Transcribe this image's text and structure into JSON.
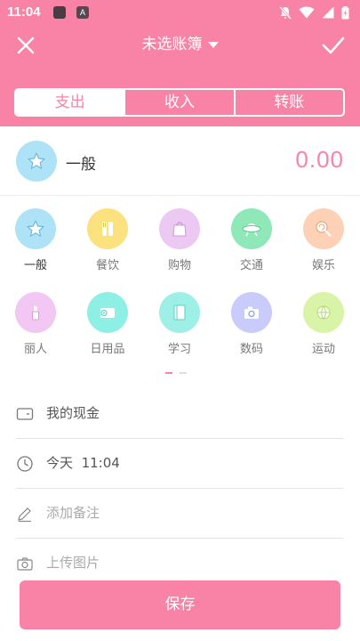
{
  "status_bar": {
    "time": "11:04"
  },
  "nav": {
    "title": "未选账簿"
  },
  "tabs": [
    {
      "label": "支出",
      "active": true
    },
    {
      "label": "收入",
      "active": false
    },
    {
      "label": "转账",
      "active": false
    }
  ],
  "amount": {
    "category": "一般",
    "value": "0.00"
  },
  "categories": [
    {
      "label": "一般",
      "icon": "star-icon",
      "color": "#aee3f7",
      "selected": true
    },
    {
      "label": "餐饮",
      "icon": "utensils-icon",
      "color": "#fbe27e",
      "selected": false
    },
    {
      "label": "购物",
      "icon": "shopping-bag-icon",
      "color": "#ebc9f3",
      "selected": false
    },
    {
      "label": "交通",
      "icon": "ufo-icon",
      "color": "#8fe8b7",
      "selected": false
    },
    {
      "label": "娱乐",
      "icon": "lollipop-icon",
      "color": "#fcd1b6",
      "selected": false
    },
    {
      "label": "丽人",
      "icon": "lipstick-icon",
      "color": "#f3c7f3",
      "selected": false
    },
    {
      "label": "日用品",
      "icon": "tissue-roll-icon",
      "color": "#8ef0e5",
      "selected": false
    },
    {
      "label": "学习",
      "icon": "book-icon",
      "color": "#9ef0e7",
      "selected": false
    },
    {
      "label": "数码",
      "icon": "camera-icon",
      "color": "#c9cbfa",
      "selected": false
    },
    {
      "label": "运动",
      "icon": "ball-icon",
      "color": "#d9f3a7",
      "selected": false
    }
  ],
  "page_indicator": {
    "pages": 2,
    "current": 1
  },
  "fields": {
    "account": "我的现金",
    "date_day": "今天",
    "date_time": "11:04",
    "note_placeholder": "添加备注",
    "photo_placeholder": "上传图片"
  },
  "save_button": {
    "label": "保存"
  },
  "colors": {
    "brand": "#f883a6",
    "divider": "#eeeeee"
  }
}
